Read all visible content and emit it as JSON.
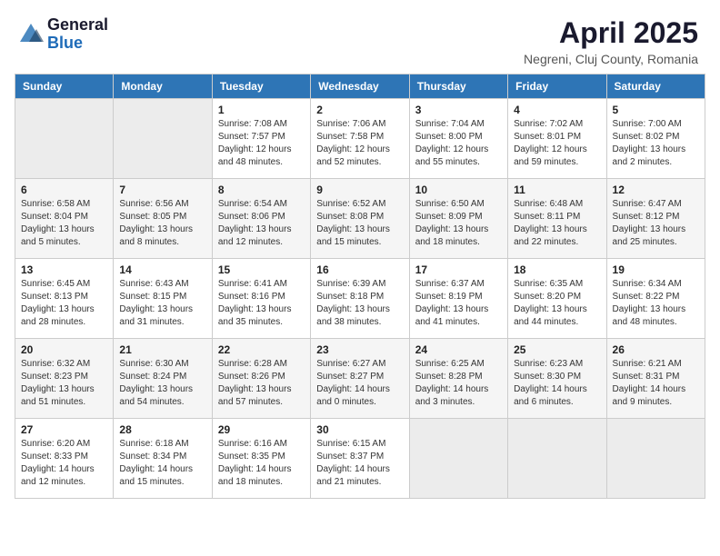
{
  "logo": {
    "general": "General",
    "blue": "Blue"
  },
  "title": {
    "month": "April 2025",
    "location": "Negreni, Cluj County, Romania"
  },
  "weekdays": [
    "Sunday",
    "Monday",
    "Tuesday",
    "Wednesday",
    "Thursday",
    "Friday",
    "Saturday"
  ],
  "weeks": [
    [
      {
        "day": "",
        "info": ""
      },
      {
        "day": "",
        "info": ""
      },
      {
        "day": "1",
        "info": "Sunrise: 7:08 AM\nSunset: 7:57 PM\nDaylight: 12 hours\nand 48 minutes."
      },
      {
        "day": "2",
        "info": "Sunrise: 7:06 AM\nSunset: 7:58 PM\nDaylight: 12 hours\nand 52 minutes."
      },
      {
        "day": "3",
        "info": "Sunrise: 7:04 AM\nSunset: 8:00 PM\nDaylight: 12 hours\nand 55 minutes."
      },
      {
        "day": "4",
        "info": "Sunrise: 7:02 AM\nSunset: 8:01 PM\nDaylight: 12 hours\nand 59 minutes."
      },
      {
        "day": "5",
        "info": "Sunrise: 7:00 AM\nSunset: 8:02 PM\nDaylight: 13 hours\nand 2 minutes."
      }
    ],
    [
      {
        "day": "6",
        "info": "Sunrise: 6:58 AM\nSunset: 8:04 PM\nDaylight: 13 hours\nand 5 minutes."
      },
      {
        "day": "7",
        "info": "Sunrise: 6:56 AM\nSunset: 8:05 PM\nDaylight: 13 hours\nand 8 minutes."
      },
      {
        "day": "8",
        "info": "Sunrise: 6:54 AM\nSunset: 8:06 PM\nDaylight: 13 hours\nand 12 minutes."
      },
      {
        "day": "9",
        "info": "Sunrise: 6:52 AM\nSunset: 8:08 PM\nDaylight: 13 hours\nand 15 minutes."
      },
      {
        "day": "10",
        "info": "Sunrise: 6:50 AM\nSunset: 8:09 PM\nDaylight: 13 hours\nand 18 minutes."
      },
      {
        "day": "11",
        "info": "Sunrise: 6:48 AM\nSunset: 8:11 PM\nDaylight: 13 hours\nand 22 minutes."
      },
      {
        "day": "12",
        "info": "Sunrise: 6:47 AM\nSunset: 8:12 PM\nDaylight: 13 hours\nand 25 minutes."
      }
    ],
    [
      {
        "day": "13",
        "info": "Sunrise: 6:45 AM\nSunset: 8:13 PM\nDaylight: 13 hours\nand 28 minutes."
      },
      {
        "day": "14",
        "info": "Sunrise: 6:43 AM\nSunset: 8:15 PM\nDaylight: 13 hours\nand 31 minutes."
      },
      {
        "day": "15",
        "info": "Sunrise: 6:41 AM\nSunset: 8:16 PM\nDaylight: 13 hours\nand 35 minutes."
      },
      {
        "day": "16",
        "info": "Sunrise: 6:39 AM\nSunset: 8:18 PM\nDaylight: 13 hours\nand 38 minutes."
      },
      {
        "day": "17",
        "info": "Sunrise: 6:37 AM\nSunset: 8:19 PM\nDaylight: 13 hours\nand 41 minutes."
      },
      {
        "day": "18",
        "info": "Sunrise: 6:35 AM\nSunset: 8:20 PM\nDaylight: 13 hours\nand 44 minutes."
      },
      {
        "day": "19",
        "info": "Sunrise: 6:34 AM\nSunset: 8:22 PM\nDaylight: 13 hours\nand 48 minutes."
      }
    ],
    [
      {
        "day": "20",
        "info": "Sunrise: 6:32 AM\nSunset: 8:23 PM\nDaylight: 13 hours\nand 51 minutes."
      },
      {
        "day": "21",
        "info": "Sunrise: 6:30 AM\nSunset: 8:24 PM\nDaylight: 13 hours\nand 54 minutes."
      },
      {
        "day": "22",
        "info": "Sunrise: 6:28 AM\nSunset: 8:26 PM\nDaylight: 13 hours\nand 57 minutes."
      },
      {
        "day": "23",
        "info": "Sunrise: 6:27 AM\nSunset: 8:27 PM\nDaylight: 14 hours\nand 0 minutes."
      },
      {
        "day": "24",
        "info": "Sunrise: 6:25 AM\nSunset: 8:28 PM\nDaylight: 14 hours\nand 3 minutes."
      },
      {
        "day": "25",
        "info": "Sunrise: 6:23 AM\nSunset: 8:30 PM\nDaylight: 14 hours\nand 6 minutes."
      },
      {
        "day": "26",
        "info": "Sunrise: 6:21 AM\nSunset: 8:31 PM\nDaylight: 14 hours\nand 9 minutes."
      }
    ],
    [
      {
        "day": "27",
        "info": "Sunrise: 6:20 AM\nSunset: 8:33 PM\nDaylight: 14 hours\nand 12 minutes."
      },
      {
        "day": "28",
        "info": "Sunrise: 6:18 AM\nSunset: 8:34 PM\nDaylight: 14 hours\nand 15 minutes."
      },
      {
        "day": "29",
        "info": "Sunrise: 6:16 AM\nSunset: 8:35 PM\nDaylight: 14 hours\nand 18 minutes."
      },
      {
        "day": "30",
        "info": "Sunrise: 6:15 AM\nSunset: 8:37 PM\nDaylight: 14 hours\nand 21 minutes."
      },
      {
        "day": "",
        "info": ""
      },
      {
        "day": "",
        "info": ""
      },
      {
        "day": "",
        "info": ""
      }
    ]
  ]
}
